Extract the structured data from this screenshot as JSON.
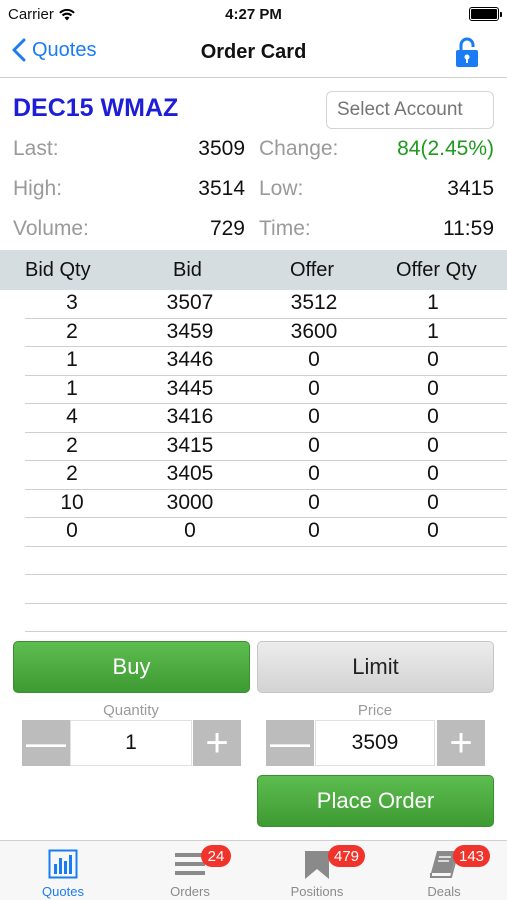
{
  "status_bar": {
    "carrier": "Carrier",
    "time": "4:27 PM"
  },
  "nav": {
    "back_label": "Quotes",
    "title": "Order Card"
  },
  "instrument": {
    "name": "DEC15 WMAZ",
    "account_placeholder": "Select Account"
  },
  "stats": {
    "last_label": "Last:",
    "last_value": "3509",
    "change_label": "Change:",
    "change_value": "84(2.45%)",
    "high_label": "High:",
    "high_value": "3514",
    "low_label": "Low:",
    "low_value": "3415",
    "volume_label": "Volume:",
    "volume_value": "729",
    "time_label": "Time:",
    "time_value": "11:59"
  },
  "depth": {
    "headers": [
      "Bid Qty",
      "Bid",
      "Offer",
      "Offer Qty"
    ],
    "rows": [
      [
        "3",
        "3507",
        "3512",
        "1"
      ],
      [
        "2",
        "3459",
        "3600",
        "1"
      ],
      [
        "1",
        "3446",
        "0",
        "0"
      ],
      [
        "1",
        "3445",
        "0",
        "0"
      ],
      [
        "4",
        "3416",
        "0",
        "0"
      ],
      [
        "2",
        "3415",
        "0",
        "0"
      ],
      [
        "2",
        "3405",
        "0",
        "0"
      ],
      [
        "10",
        "3000",
        "0",
        "0"
      ],
      [
        "0",
        "0",
        "0",
        "0"
      ],
      [
        "",
        "",
        "",
        ""
      ],
      [
        "",
        "",
        "",
        ""
      ],
      [
        "",
        "",
        "",
        ""
      ]
    ]
  },
  "order": {
    "buy_label": "Buy",
    "limit_label": "Limit",
    "quantity_label": "Quantity",
    "quantity_value": "1",
    "price_label": "Price",
    "price_value": "3509",
    "minus_symbol": "—",
    "plus_symbol": "+",
    "place_order_label": "Place Order"
  },
  "tabs": [
    {
      "label": "Quotes",
      "icon": "bar-chart-icon"
    },
    {
      "label": "Orders",
      "icon": "list-icon",
      "badge": "24"
    },
    {
      "label": "Positions",
      "icon": "flag-icon",
      "badge": "479"
    },
    {
      "label": "Deals",
      "icon": "book-icon",
      "badge": "143"
    }
  ],
  "colors": {
    "accent": "#1a7cf5",
    "instrument": "#1e1ed8",
    "positive": "#1f9a1f",
    "buy": "#4aa93e",
    "badge": "#f0342c"
  }
}
